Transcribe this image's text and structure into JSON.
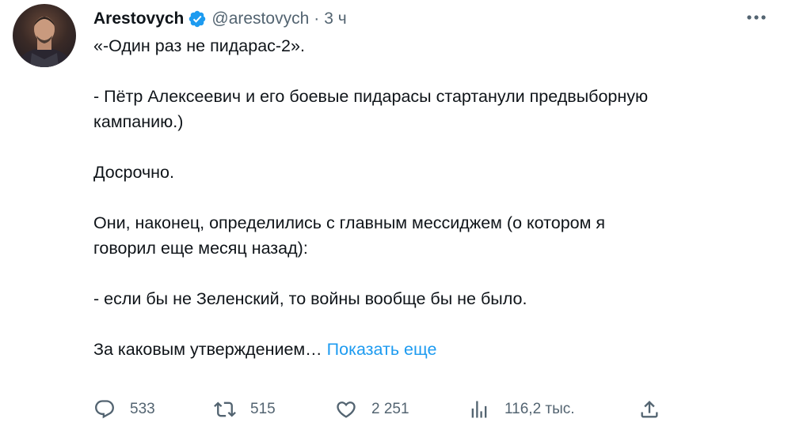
{
  "author": {
    "name": "Arestovych",
    "handle": "@arestovych",
    "separator": "·",
    "time": "3 ч"
  },
  "tweet": {
    "paragraphs": [
      [
        "«-Один раз не пидарас-2»."
      ],
      [
        "- Пётр Алексеевич и его боевые пидарасы стартанули предвыборную",
        "кампанию.)"
      ],
      [
        "Досрочно."
      ],
      [
        "Они, наконец, определились с главным мессиджем (о котором я",
        "говорил еще месяц назад):"
      ],
      [
        "- если бы не Зеленский, то войны вообще бы не было."
      ]
    ],
    "last_line": "За каковым утверждением…",
    "show_more": "Показать еще"
  },
  "actions": {
    "replies": "533",
    "retweets": "515",
    "likes": "2 251",
    "views": "116,2 тыс."
  },
  "colors": {
    "text": "#0f1419",
    "secondary": "#536471",
    "link": "#1d9bf0",
    "verified": "#1d9bf0"
  },
  "icons": {
    "more": "more-horizontal-icon",
    "reply": "reply-icon",
    "retweet": "retweet-icon",
    "like": "heart-icon",
    "views": "views-icon",
    "share": "share-icon",
    "verified": "verified-badge-icon"
  }
}
